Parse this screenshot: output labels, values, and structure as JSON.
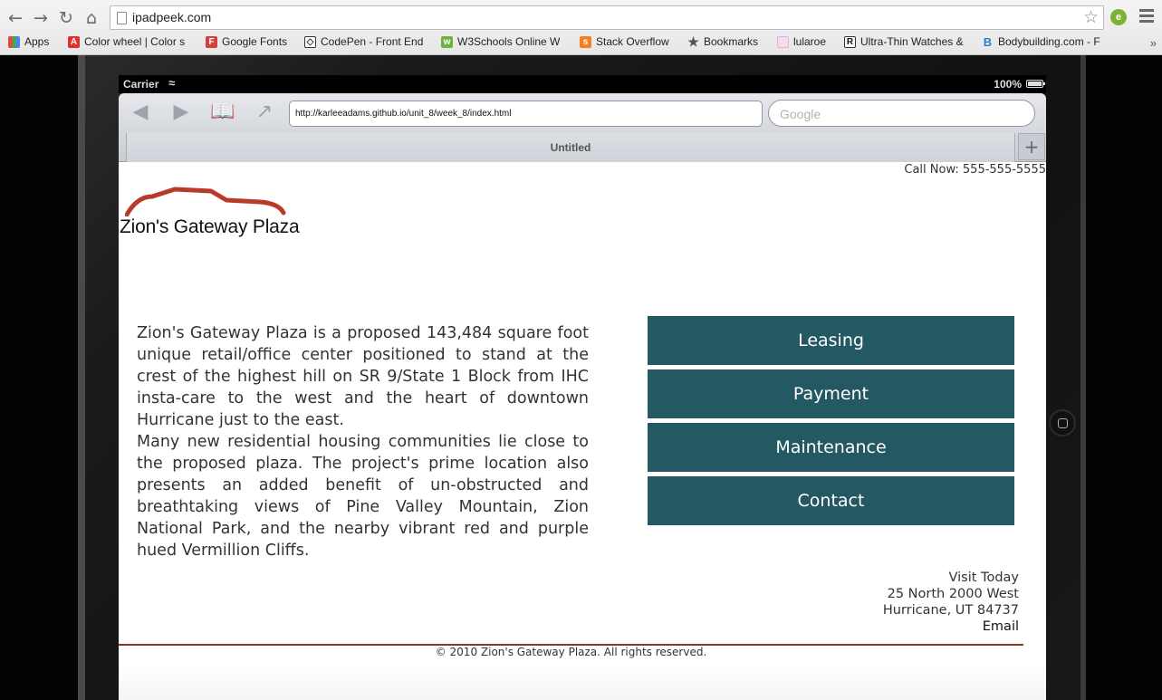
{
  "browser": {
    "url": "ipadpeek.com",
    "bookmarks": [
      {
        "label": "Apps",
        "icon": "apps-grid-icon"
      },
      {
        "label": "Color wheel | Color s",
        "icon": "adobe-icon"
      },
      {
        "label": "Google Fonts",
        "icon": "google-fonts-icon"
      },
      {
        "label": "CodePen - Front End",
        "icon": "codepen-icon"
      },
      {
        "label": "W3Schools Online W",
        "icon": "w3schools-icon"
      },
      {
        "label": "Stack Overflow",
        "icon": "stackoverflow-icon"
      },
      {
        "label": "Bookmarks",
        "icon": "star-icon"
      },
      {
        "label": "lularoe",
        "icon": "lularoe-icon"
      },
      {
        "label": "Ultra-Thin Watches &",
        "icon": "watch-r-icon"
      },
      {
        "label": "Bodybuilding.com - F",
        "icon": "bodybuilding-icon"
      }
    ]
  },
  "ipad": {
    "carrier": "Carrier",
    "battery": "100%",
    "safari_url": "http://karleeadams.github.io/unit_8/week_8/index.html",
    "search_placeholder": "Google",
    "tab_title": "Untitled"
  },
  "page": {
    "call_now": "Call Now: 555-555-5555",
    "logo_text": "Zion's Gateway Plaza",
    "intro_p1": "Zion's Gateway Plaza is a proposed 143,484 square foot unique retail/office center positioned to stand at the crest of the highest hill on SR 9/State 1 Block from IHC insta-care to the west and the heart of downtown Hurricane just to the east.",
    "intro_p2": "Many new residential housing communities lie close to the proposed plaza. The project's prime location also presents an added benefit of un-obstructed and breathtaking views of Pine Valley Mountain, Zion National Park, and the nearby vibrant red and purple hued Vermillion Cliffs.",
    "menu": [
      "Leasing",
      "Payment",
      "Maintenance",
      "Contact"
    ],
    "contact": {
      "heading": "Visit Today",
      "street": "25 North 2000 West",
      "city": "Hurricane, UT 84737",
      "email": "Email"
    },
    "footer": "© 2010 Zion's Gateway Plaza. All rights reserved."
  },
  "colors": {
    "menu_bg": "#245963",
    "logo_red": "#b83a28",
    "footer_rule": "#8a3a26"
  }
}
